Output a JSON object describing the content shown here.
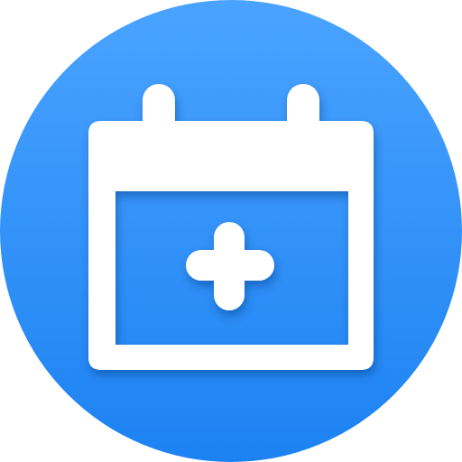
{
  "icon": {
    "name": "add-calendar-event-icon",
    "colors": {
      "background_top": "#4aa3ff",
      "background_bottom": "#1c82f2",
      "glyph": "#ffffff",
      "window": "#2e8ff7",
      "shadow": "#0b3d80"
    }
  }
}
